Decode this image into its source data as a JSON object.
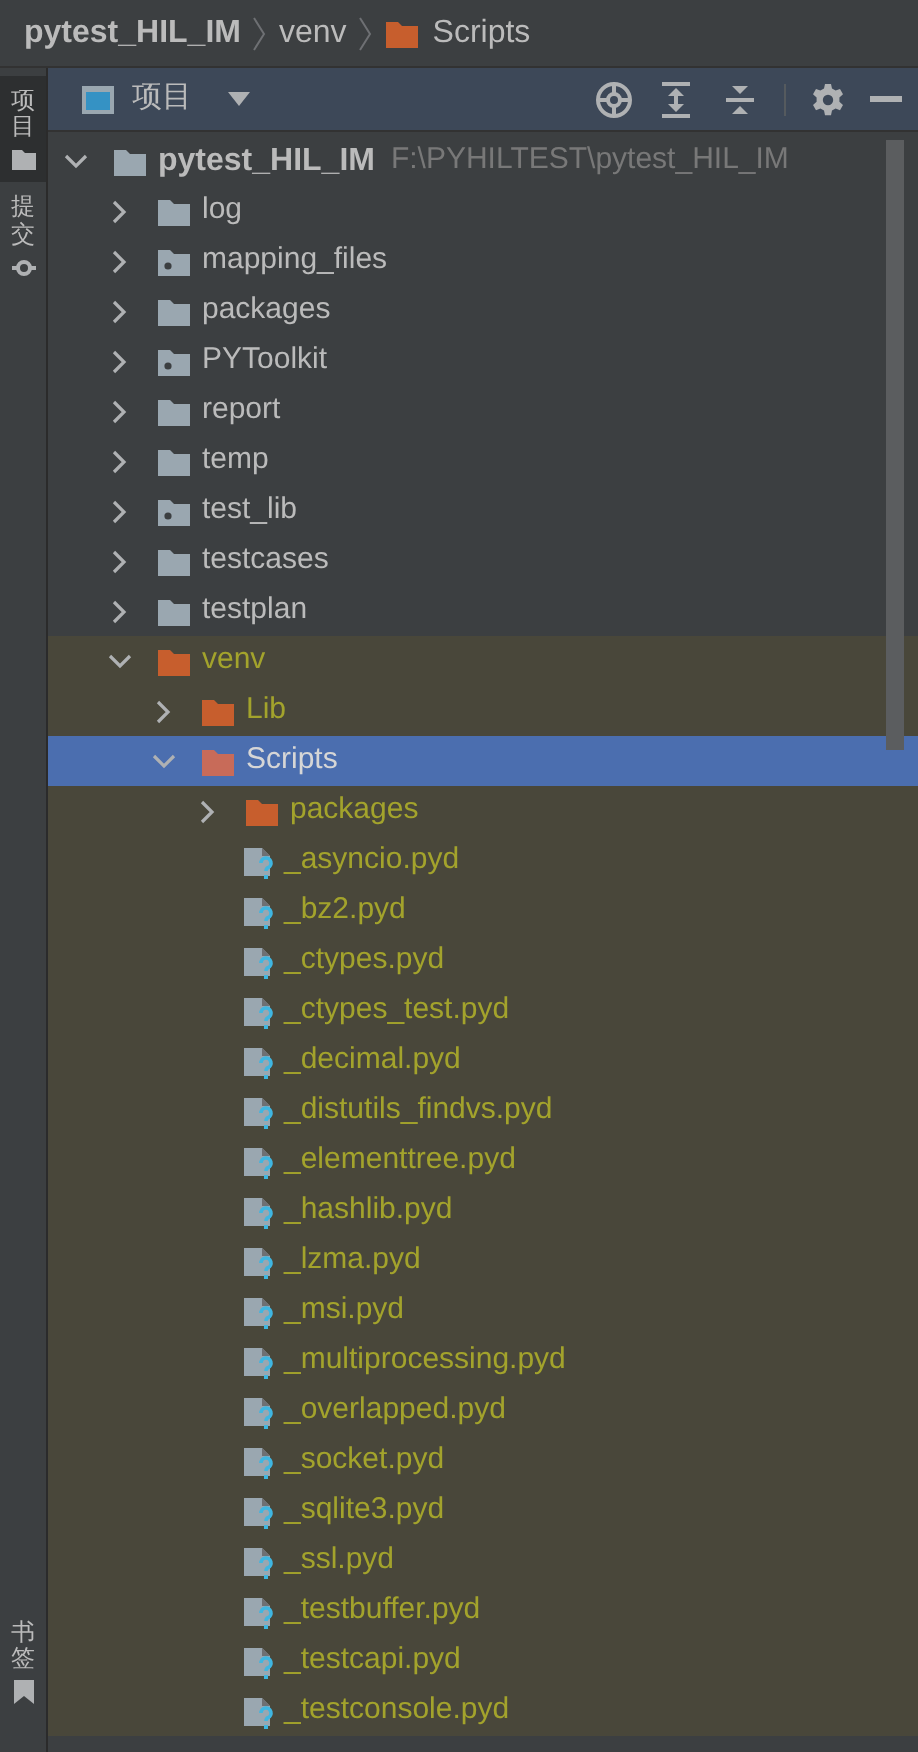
{
  "breadcrumb": [
    {
      "label": "pytest_HIL_IM",
      "kind": "project"
    },
    {
      "label": "venv",
      "kind": "plain"
    },
    {
      "label": "Scripts",
      "kind": "folder"
    }
  ],
  "side_tabs": [
    {
      "label": "项目",
      "kind": "project",
      "selected": true
    },
    {
      "label": "提交",
      "kind": "commit",
      "selected": false
    },
    {
      "label": "书签",
      "kind": "bookmark",
      "selected": false
    }
  ],
  "panel": {
    "title": "项目"
  },
  "tree": [
    {
      "label": "pytest_HIL_IM",
      "path": "F:\\PYHILTEST\\pytest_HIL_IM",
      "kind": "folder",
      "expanded": true,
      "selected": false,
      "children": [
        {
          "label": "log",
          "kind": "folder",
          "expanded": false,
          "selected": false
        },
        {
          "label": "mapping_files",
          "kind": "module",
          "expanded": false,
          "selected": false
        },
        {
          "label": "packages",
          "kind": "folder",
          "expanded": false,
          "selected": false
        },
        {
          "label": "PYToolkit",
          "kind": "module",
          "expanded": false,
          "selected": false
        },
        {
          "label": "report",
          "kind": "folder",
          "expanded": false,
          "selected": false
        },
        {
          "label": "temp",
          "kind": "folder",
          "expanded": false,
          "selected": false
        },
        {
          "label": "test_lib",
          "kind": "module",
          "expanded": false,
          "selected": false
        },
        {
          "label": "testcases",
          "kind": "folder",
          "expanded": false,
          "selected": false
        },
        {
          "label": "testplan",
          "kind": "folder",
          "expanded": false,
          "selected": false
        },
        {
          "label": "venv",
          "kind": "excluded",
          "expanded": true,
          "selected": false,
          "children": [
            {
              "label": "Lib",
              "kind": "excluded",
              "expanded": false,
              "selected": false
            },
            {
              "label": "Scripts",
              "kind": "excluded",
              "expanded": true,
              "selected": true,
              "children": [
                {
                  "label": "packages",
                  "kind": "excluded",
                  "expanded": false,
                  "selected": false
                },
                {
                  "label": "_asyncio.pyd",
                  "kind": "file",
                  "selected": false
                },
                {
                  "label": "_bz2.pyd",
                  "kind": "file",
                  "selected": false
                },
                {
                  "label": "_ctypes.pyd",
                  "kind": "file",
                  "selected": false
                },
                {
                  "label": "_ctypes_test.pyd",
                  "kind": "file",
                  "selected": false
                },
                {
                  "label": "_decimal.pyd",
                  "kind": "file",
                  "selected": false
                },
                {
                  "label": "_distutils_findvs.pyd",
                  "kind": "file",
                  "selected": false
                },
                {
                  "label": "_elementtree.pyd",
                  "kind": "file",
                  "selected": false
                },
                {
                  "label": "_hashlib.pyd",
                  "kind": "file",
                  "selected": false
                },
                {
                  "label": "_lzma.pyd",
                  "kind": "file",
                  "selected": false
                },
                {
                  "label": "_msi.pyd",
                  "kind": "file",
                  "selected": false
                },
                {
                  "label": "_multiprocessing.pyd",
                  "kind": "file",
                  "selected": false
                },
                {
                  "label": "_overlapped.pyd",
                  "kind": "file",
                  "selected": false
                },
                {
                  "label": "_socket.pyd",
                  "kind": "file",
                  "selected": false
                },
                {
                  "label": "_sqlite3.pyd",
                  "kind": "file",
                  "selected": false
                },
                {
                  "label": "_ssl.pyd",
                  "kind": "file",
                  "selected": false
                },
                {
                  "label": "_testbuffer.pyd",
                  "kind": "file",
                  "selected": false
                },
                {
                  "label": "_testcapi.pyd",
                  "kind": "file",
                  "selected": false
                },
                {
                  "label": "_testconsole.pyd",
                  "kind": "file",
                  "selected": false
                }
              ]
            }
          ]
        }
      ]
    }
  ]
}
